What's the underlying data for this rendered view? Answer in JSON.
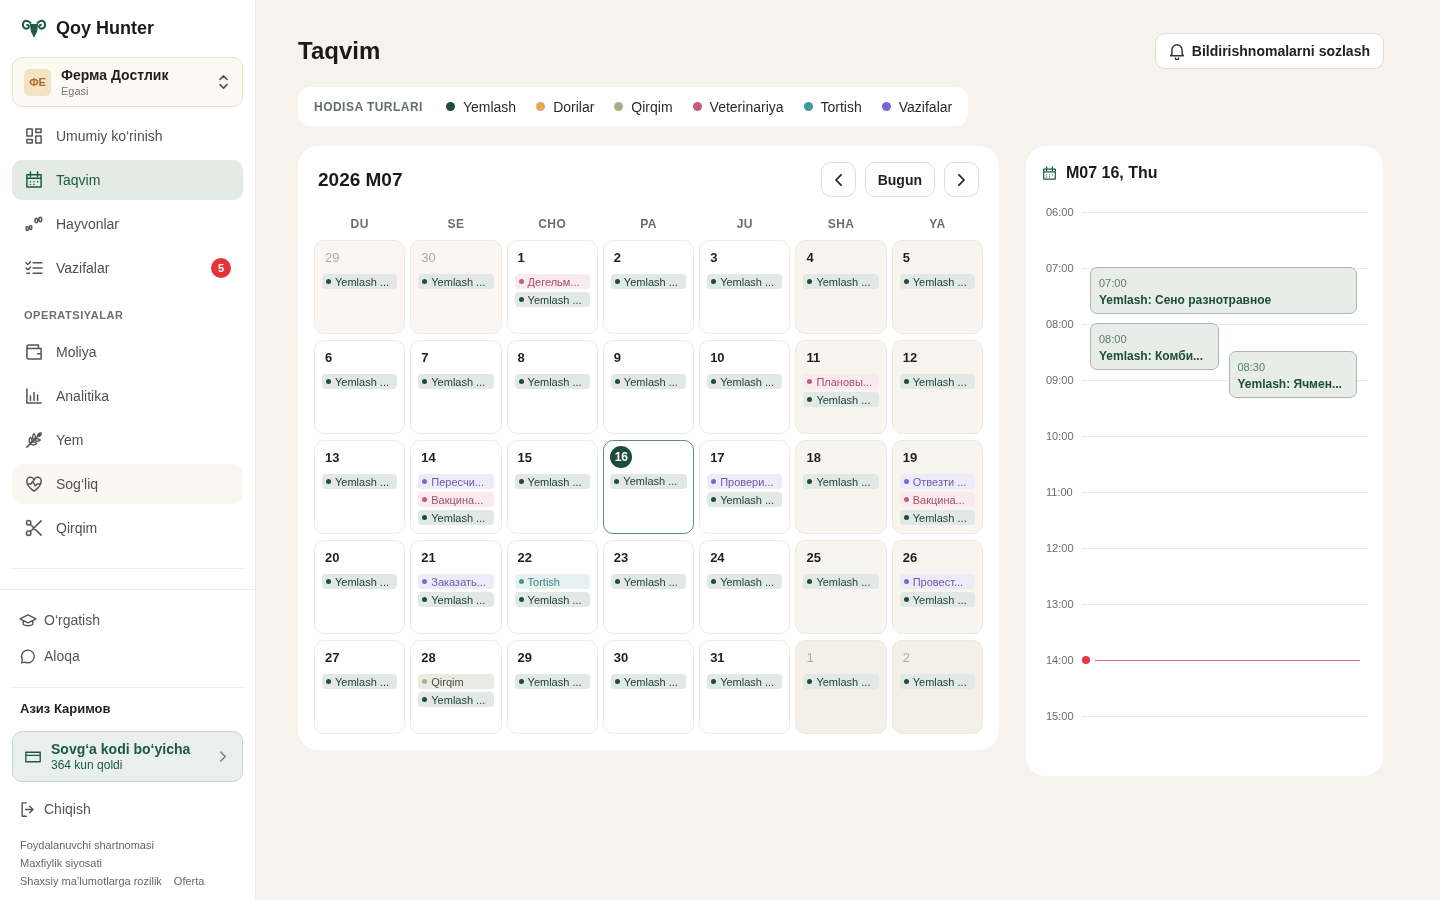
{
  "sidebar": {
    "brand": "Qoy Hunter",
    "farm": {
      "initials": "ФЕ",
      "name": "Ферма Достлик",
      "role": "Egasi"
    },
    "sections": [
      {
        "items": [
          {
            "label": "Umumiy ko‘rinish",
            "selected": false,
            "hovered": false
          },
          {
            "label": "Taqvim",
            "selected": true,
            "hovered": false
          },
          {
            "label": "Hayvonlar",
            "selected": false,
            "hovered": false
          },
          {
            "label": "Vazifalar",
            "badge": "5",
            "selected": false,
            "hovered": false
          }
        ]
      },
      {
        "title": "OPERATSIYALAR",
        "items": [
          {
            "label": "Moliya",
            "selected": false,
            "hovered": false
          },
          {
            "label": "Analitika",
            "selected": false,
            "hovered": false
          },
          {
            "label": "Yem",
            "selected": false,
            "hovered": false
          },
          {
            "label": "Sog‘liq",
            "selected": false,
            "hovered": true
          },
          {
            "label": "Qirqim",
            "selected": false,
            "hovered": false
          }
        ]
      }
    ],
    "secondary": [
      "O‘rgatish",
      "Aloqa"
    ],
    "user_name": "Азиз Каримов",
    "plan": {
      "title": "Sovg‘a kodi bo‘yicha",
      "subtitle": "364 kun qoldi"
    },
    "logout": "Chiqish",
    "legal_links": [
      "Foydalanuvchi shartnomasi",
      "Maxfiylik siyosati",
      "Shaxsiy ma’lumotlarga rozilik",
      "Oferta"
    ]
  },
  "page": {
    "title": "Taqvim",
    "notification_button": "Bildirishnomalarni sozlash"
  },
  "legend": {
    "label": "HODISA TURLARI",
    "items": [
      {
        "label": "Yemlash",
        "color": "#1f4d3b"
      },
      {
        "label": "Dorilar",
        "color": "#e3a55a"
      },
      {
        "label": "Qirqim",
        "color": "#a3b18a"
      },
      {
        "label": "Veterinariya",
        "color": "#c75b7a"
      },
      {
        "label": "Tortish",
        "color": "#3d9a98"
      },
      {
        "label": "Vazifalar",
        "color": "#7a68d0"
      }
    ]
  },
  "calendar": {
    "title": "2026 M07",
    "today_button": "Bugun",
    "weekdays": [
      "DU",
      "SE",
      "CHO",
      "PA",
      "JU",
      "SHA",
      "YA"
    ],
    "weeks": [
      {
        "days": [
          {
            "day": "29",
            "outside_month": true,
            "weekend": false,
            "today": false,
            "events": [
              {
                "label": "Yemlash ...",
                "color": "#1f4d3b"
              }
            ]
          },
          {
            "day": "30",
            "outside_month": true,
            "weekend": false,
            "today": false,
            "events": [
              {
                "label": "Yemlash ...",
                "color": "#1f4d3b"
              }
            ]
          },
          {
            "day": "1",
            "outside_month": false,
            "weekend": false,
            "today": false,
            "events": [
              {
                "label": "Дегельм...",
                "color": "#c75b7a"
              },
              {
                "label": "Yemlash ...",
                "color": "#1f4d3b"
              }
            ]
          },
          {
            "day": "2",
            "outside_month": false,
            "weekend": false,
            "today": false,
            "events": [
              {
                "label": "Yemlash ...",
                "color": "#1f4d3b"
              }
            ]
          },
          {
            "day": "3",
            "outside_month": false,
            "weekend": false,
            "today": false,
            "events": [
              {
                "label": "Yemlash ...",
                "color": "#1f4d3b"
              }
            ]
          },
          {
            "day": "4",
            "outside_month": false,
            "weekend": true,
            "today": false,
            "events": [
              {
                "label": "Yemlash ...",
                "color": "#1f4d3b"
              }
            ]
          },
          {
            "day": "5",
            "outside_month": false,
            "weekend": true,
            "today": false,
            "events": [
              {
                "label": "Yemlash ...",
                "color": "#1f4d3b"
              }
            ]
          }
        ]
      },
      {
        "days": [
          {
            "day": "6",
            "outside_month": false,
            "weekend": false,
            "today": false,
            "events": [
              {
                "label": "Yemlash ...",
                "color": "#1f4d3b"
              }
            ]
          },
          {
            "day": "7",
            "outside_month": false,
            "weekend": false,
            "today": false,
            "events": [
              {
                "label": "Yemlash ...",
                "color": "#1f4d3b"
              }
            ]
          },
          {
            "day": "8",
            "outside_month": false,
            "weekend": false,
            "today": false,
            "events": [
              {
                "label": "Yemlash ...",
                "color": "#1f4d3b"
              }
            ]
          },
          {
            "day": "9",
            "outside_month": false,
            "weekend": false,
            "today": false,
            "events": [
              {
                "label": "Yemlash ...",
                "color": "#1f4d3b"
              }
            ]
          },
          {
            "day": "10",
            "outside_month": false,
            "weekend": false,
            "today": false,
            "events": [
              {
                "label": "Yemlash ...",
                "color": "#1f4d3b"
              }
            ]
          },
          {
            "day": "11",
            "outside_month": false,
            "weekend": true,
            "today": false,
            "events": [
              {
                "label": "Плановы...",
                "color": "#c75b7a"
              },
              {
                "label": "Yemlash ...",
                "color": "#1f4d3b"
              }
            ]
          },
          {
            "day": "12",
            "outside_month": false,
            "weekend": true,
            "today": false,
            "events": [
              {
                "label": "Yemlash ...",
                "color": "#1f4d3b"
              }
            ]
          }
        ]
      },
      {
        "days": [
          {
            "day": "13",
            "outside_month": false,
            "weekend": false,
            "today": false,
            "events": [
              {
                "label": "Yemlash ...",
                "color": "#1f4d3b"
              }
            ]
          },
          {
            "day": "14",
            "outside_month": false,
            "weekend": false,
            "today": false,
            "events": [
              {
                "label": "Пересчи...",
                "color": "#7a68d0"
              },
              {
                "label": "Вакцина...",
                "color": "#c75b7a"
              },
              {
                "label": "Yemlash ...",
                "color": "#1f4d3b"
              }
            ]
          },
          {
            "day": "15",
            "outside_month": false,
            "weekend": false,
            "today": false,
            "events": [
              {
                "label": "Yemlash ...",
                "color": "#1f4d3b"
              }
            ]
          },
          {
            "day": "16",
            "outside_month": false,
            "weekend": false,
            "today": true,
            "events": [
              {
                "label": "Yemlash ...",
                "color": "#1f4d3b"
              }
            ]
          },
          {
            "day": "17",
            "outside_month": false,
            "weekend": false,
            "today": false,
            "events": [
              {
                "label": "Провери...",
                "color": "#7a68d0"
              },
              {
                "label": "Yemlash ...",
                "color": "#1f4d3b"
              }
            ]
          },
          {
            "day": "18",
            "outside_month": false,
            "weekend": true,
            "today": false,
            "events": [
              {
                "label": "Yemlash ...",
                "color": "#1f4d3b"
              }
            ]
          },
          {
            "day": "19",
            "outside_month": false,
            "weekend": true,
            "today": false,
            "events": [
              {
                "label": "Отвезти ...",
                "color": "#7a68d0"
              },
              {
                "label": "Вакцина...",
                "color": "#c75b7a"
              },
              {
                "label": "Yemlash ...",
                "color": "#1f4d3b"
              }
            ]
          }
        ]
      },
      {
        "days": [
          {
            "day": "20",
            "outside_month": false,
            "weekend": false,
            "today": false,
            "events": [
              {
                "label": "Yemlash ...",
                "color": "#1f4d3b"
              }
            ]
          },
          {
            "day": "21",
            "outside_month": false,
            "weekend": false,
            "today": false,
            "events": [
              {
                "label": "Заказать...",
                "color": "#7a68d0"
              },
              {
                "label": "Yemlash ...",
                "color": "#1f4d3b"
              }
            ]
          },
          {
            "day": "22",
            "outside_month": false,
            "weekend": false,
            "today": false,
            "events": [
              {
                "label": "Tortish",
                "color": "#3d9a98"
              },
              {
                "label": "Yemlash ...",
                "color": "#1f4d3b"
              }
            ]
          },
          {
            "day": "23",
            "outside_month": false,
            "weekend": false,
            "today": false,
            "events": [
              {
                "label": "Yemlash ...",
                "color": "#1f4d3b"
              }
            ]
          },
          {
            "day": "24",
            "outside_month": false,
            "weekend": false,
            "today": false,
            "events": [
              {
                "label": "Yemlash ...",
                "color": "#1f4d3b"
              }
            ]
          },
          {
            "day": "25",
            "outside_month": false,
            "weekend": true,
            "today": false,
            "events": [
              {
                "label": "Yemlash ...",
                "color": "#1f4d3b"
              }
            ]
          },
          {
            "day": "26",
            "outside_month": false,
            "weekend": true,
            "today": false,
            "events": [
              {
                "label": "Провест...",
                "color": "#7a68d0"
              },
              {
                "label": "Yemlash ...",
                "color": "#1f4d3b"
              }
            ]
          }
        ]
      },
      {
        "days": [
          {
            "day": "27",
            "outside_month": false,
            "weekend": false,
            "today": false,
            "events": [
              {
                "label": "Yemlash ...",
                "color": "#1f4d3b"
              }
            ]
          },
          {
            "day": "28",
            "outside_month": false,
            "weekend": false,
            "today": false,
            "events": [
              {
                "label": "Qirqim",
                "color": "#a3b18a"
              },
              {
                "label": "Yemlash ...",
                "color": "#1f4d3b"
              }
            ]
          },
          {
            "day": "29",
            "outside_month": false,
            "weekend": false,
            "today": false,
            "events": [
              {
                "label": "Yemlash ...",
                "color": "#1f4d3b"
              }
            ]
          },
          {
            "day": "30",
            "outside_month": false,
            "weekend": false,
            "today": false,
            "events": [
              {
                "label": "Yemlash ...",
                "color": "#1f4d3b"
              }
            ]
          },
          {
            "day": "31",
            "outside_month": false,
            "weekend": false,
            "today": false,
            "events": [
              {
                "label": "Yemlash ...",
                "color": "#1f4d3b"
              }
            ]
          },
          {
            "day": "1",
            "outside_month": true,
            "weekend": true,
            "today": false,
            "events": [
              {
                "label": "Yemlash ...",
                "color": "#1f4d3b"
              }
            ]
          },
          {
            "day": "2",
            "outside_month": true,
            "weekend": true,
            "today": false,
            "events": [
              {
                "label": "Yemlash ...",
                "color": "#1f4d3b"
              }
            ]
          }
        ]
      }
    ]
  },
  "day_panel": {
    "title": "M07 16, Thu",
    "hours": [
      {
        "label": "06:00",
        "now": false
      },
      {
        "label": "07:00",
        "now": false
      },
      {
        "label": "08:00",
        "now": false
      },
      {
        "label": "09:00",
        "now": false
      },
      {
        "label": "10:00",
        "now": false
      },
      {
        "label": "11:00",
        "now": false
      },
      {
        "label": "12:00",
        "now": false
      },
      {
        "label": "13:00",
        "now": false
      },
      {
        "label": "14:00",
        "now": true
      },
      {
        "label": "15:00",
        "now": false
      }
    ],
    "events": [
      {
        "time": "07:00",
        "title": "Yemlash: Сено разнотравное"
      },
      {
        "time": "08:00",
        "title": "Yemlash: Комби..."
      },
      {
        "time": "08:30",
        "title": "Yemlash: Ячмен..."
      }
    ]
  }
}
